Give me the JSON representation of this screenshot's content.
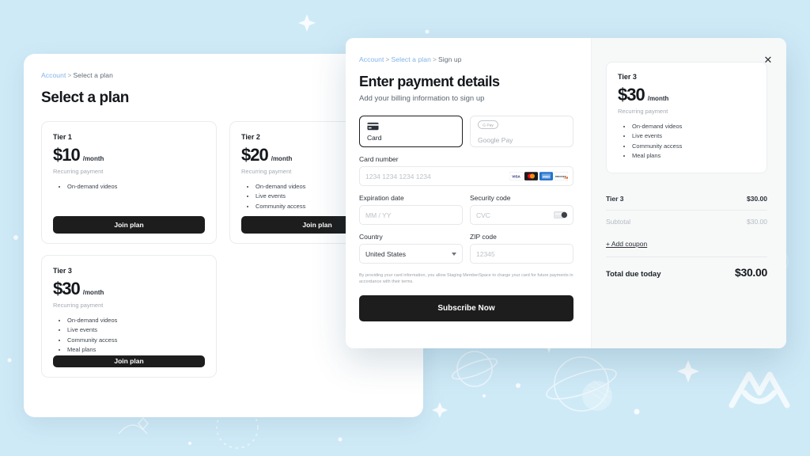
{
  "background": {
    "color": "#cfeaf7",
    "watermark_logo": "memberspace-m-logo",
    "decor": "space-doodles"
  },
  "plan_panel": {
    "breadcrumb": {
      "account": "Account",
      "separator": ">",
      "current": "Select a plan"
    },
    "title": "Select a plan",
    "cards": [
      {
        "tier": "Tier 1",
        "price": "$10",
        "per": "/month",
        "recurring": "Recurring payment",
        "features": [
          "On-demand videos"
        ],
        "cta": "Join plan"
      },
      {
        "tier": "Tier 2",
        "price": "$20",
        "per": "/month",
        "recurring": "Recurring payment",
        "features": [
          "On-demand videos",
          "Live events",
          "Community access"
        ],
        "cta": "Join plan"
      },
      {
        "tier": "Tier 3",
        "price": "$30",
        "per": "/month",
        "recurring": "Recurring payment",
        "features": [
          "On-demand videos",
          "Live events",
          "Community access",
          "Meal plans"
        ],
        "cta": "Join plan"
      }
    ]
  },
  "modal": {
    "close_label": "✕",
    "breadcrumb": {
      "account": "Account",
      "sep1": ">",
      "plan": "Select a plan",
      "sep2": ">",
      "current": "Sign up"
    },
    "title": "Enter payment details",
    "subtitle": "Add your billing information to sign up",
    "payment_tabs": [
      {
        "label": "Card",
        "icon": "credit-card-icon",
        "selected": true
      },
      {
        "label": "Google Pay",
        "icon": "google-pay-icon",
        "selected": false
      }
    ],
    "fields": {
      "card_number": {
        "label": "Card number",
        "placeholder": "1234 1234 1234 1234",
        "value": "",
        "brands": [
          "visa",
          "mastercard",
          "amex",
          "discover"
        ]
      },
      "expiration": {
        "label": "Expiration date",
        "placeholder": "MM / YY",
        "value": ""
      },
      "security": {
        "label": "Security code",
        "placeholder": "CVC",
        "value": ""
      },
      "country": {
        "label": "Country",
        "value": "United States"
      },
      "zip": {
        "label": "ZIP code",
        "placeholder": "12345",
        "value": ""
      }
    },
    "fineprint": "By providing your card information, you allow Staging MemberSpace to charge your card for future payments in accordance with their terms.",
    "submit_label": "Subscribe Now",
    "summary": {
      "plan_card": {
        "tier": "Tier 3",
        "price": "$30",
        "per": "/month",
        "recurring": "Recurring payment",
        "features": [
          "On-demand videos",
          "Live events",
          "Community access",
          "Meal plans"
        ]
      },
      "line_items": [
        {
          "label": "Tier 3",
          "amount": "$30.00",
          "muted": false
        },
        {
          "label": "Subtotal",
          "amount": "$30.00",
          "muted": true
        }
      ],
      "coupon_label": "+ Add coupon",
      "total_label": "Total due today",
      "total_amount": "$30.00"
    }
  },
  "colors": {
    "background": "#cfeaf7",
    "surface": "#ffffff",
    "button_dark": "#1d1d1d",
    "link_blue": "#7fb3e8",
    "muted_text": "#a3abb3"
  }
}
